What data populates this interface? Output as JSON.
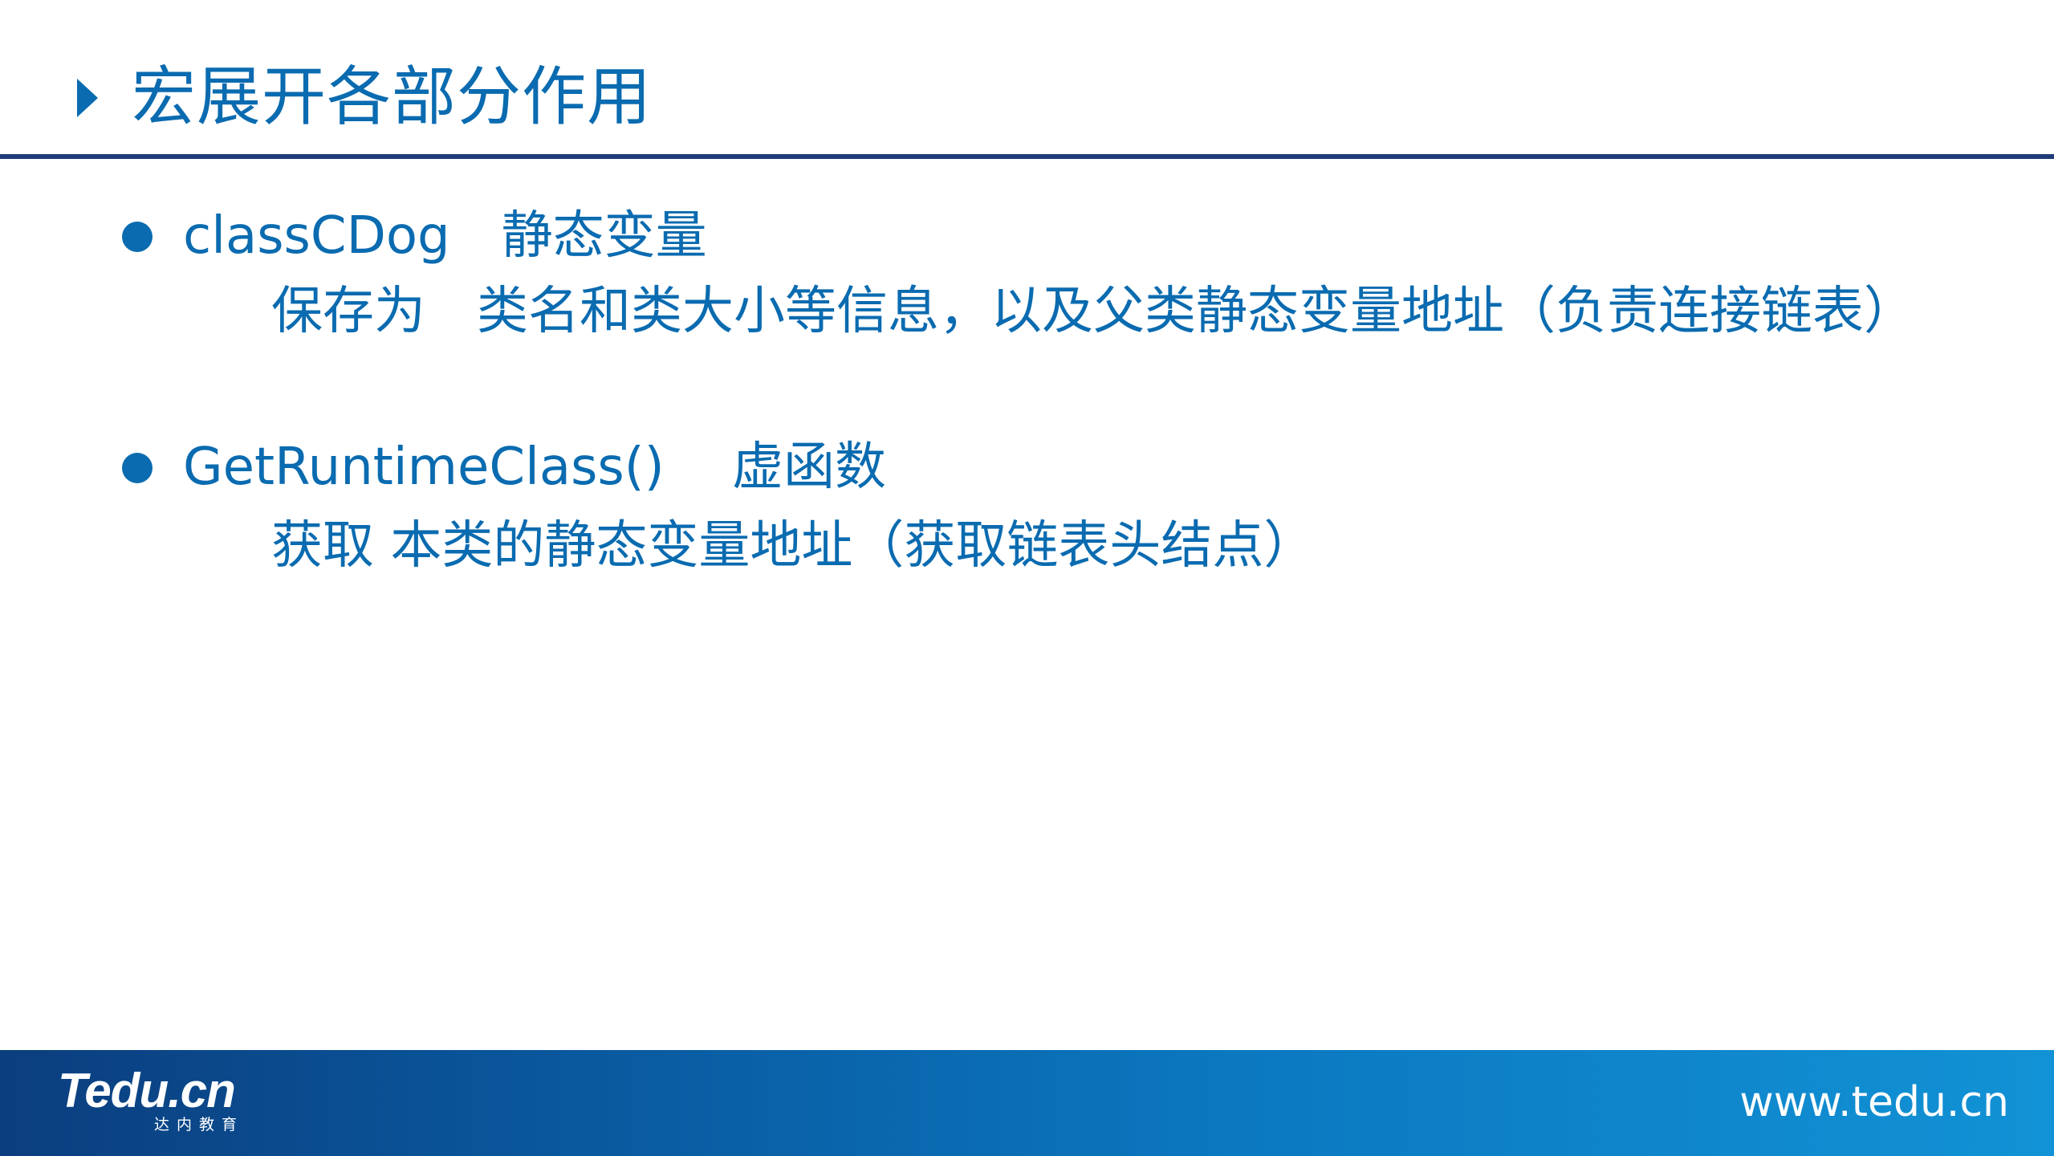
{
  "title": "宏展开各部分作用",
  "bullets": [
    {
      "heading": "classCDog　静态变量",
      "detail": "保存为　类名和类大小等信息，以及父类静态变量地址（负责连接链表）"
    },
    {
      "heading": "GetRuntimeClass()　 虚函数",
      "detail": "获取 本类的静态变量地址（获取链表头结点）"
    }
  ],
  "footer": {
    "logo_text": "Tedu.cn",
    "logo_subtitle": "达内教育",
    "url": "www.tedu.cn"
  },
  "colors": {
    "accent": "#0a6bb0",
    "rule": "#1f3c7a",
    "footer_start": "#0b3e7e",
    "footer_end": "#1292d6"
  }
}
